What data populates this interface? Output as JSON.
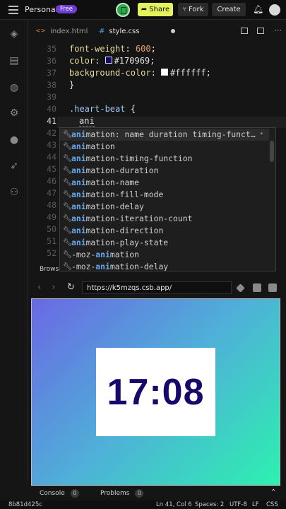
{
  "header": {
    "project": "Personal",
    "plan": "Free",
    "share": "Share",
    "fork": "Fork",
    "create": "Create"
  },
  "tabs": [
    {
      "label": "index.html"
    },
    {
      "label": "style.css"
    }
  ],
  "editor": {
    "lines": [
      {
        "num": "35",
        "prop": "font-weight",
        "value": "600"
      },
      {
        "num": "36",
        "prop": "color",
        "value": "#170969"
      },
      {
        "num": "37",
        "prop": "background-color",
        "value": "#ffffff"
      },
      {
        "num": "38",
        "text": "}"
      },
      {
        "num": "39",
        "text": ""
      },
      {
        "num": "40",
        "selector": ".heart-beat",
        "text": " {"
      },
      {
        "num": "41",
        "typed": "ani"
      },
      {
        "num": "42"
      },
      {
        "num": "43"
      },
      {
        "num": "44"
      },
      {
        "num": "45"
      },
      {
        "num": "46"
      },
      {
        "num": "47"
      },
      {
        "num": "48"
      },
      {
        "num": "49"
      },
      {
        "num": "50"
      },
      {
        "num": "51"
      },
      {
        "num": "52"
      },
      {
        "num": "53"
      }
    ],
    "swatch_colors": [
      "#170969",
      "#ffffff"
    ]
  },
  "suggestions": [
    {
      "match": "ani",
      "rest": "mation: name duration timing-funct…",
      "extra": "•"
    },
    {
      "match": "ani",
      "rest": "mation"
    },
    {
      "match": "ani",
      "rest": "mation-timing-function"
    },
    {
      "match": "ani",
      "rest": "mation-duration"
    },
    {
      "match": "ani",
      "rest": "mation-name"
    },
    {
      "match": "ani",
      "rest": "mation-fill-mode"
    },
    {
      "match": "ani",
      "rest": "mation-delay"
    },
    {
      "match": "ani",
      "rest": "mation-iteration-count"
    },
    {
      "match": "ani",
      "rest": "mation-direction"
    },
    {
      "match": "ani",
      "rest": "mation-play-state"
    },
    {
      "prefix": "-moz-",
      "match": "ani",
      "rest": "mation"
    },
    {
      "prefix": "-moz-",
      "match": "ani",
      "rest": "mation-delay"
    }
  ],
  "browser": {
    "label": "Browser",
    "url": "https://k5mzqs.csb.app/"
  },
  "preview": {
    "time": "17:08",
    "text_color": "#170969"
  },
  "panels": [
    {
      "label": "Console",
      "count": "0"
    },
    {
      "label": "Problems",
      "count": "0"
    }
  ],
  "status": {
    "commit": "8b81d425c",
    "position": "Ln 41, Col 6",
    "spaces": "Spaces: 2",
    "encoding": "UTF-8",
    "eol": "LF",
    "language": "CSS"
  },
  "icons": [
    "menu-icon",
    "save-icon",
    "share-arrow-icon",
    "fork-icon",
    "bell-icon",
    "avatar",
    "cube-icon",
    "file-icon",
    "search-icon",
    "gear-icon",
    "github-icon",
    "rocket-icon",
    "users-icon"
  ]
}
